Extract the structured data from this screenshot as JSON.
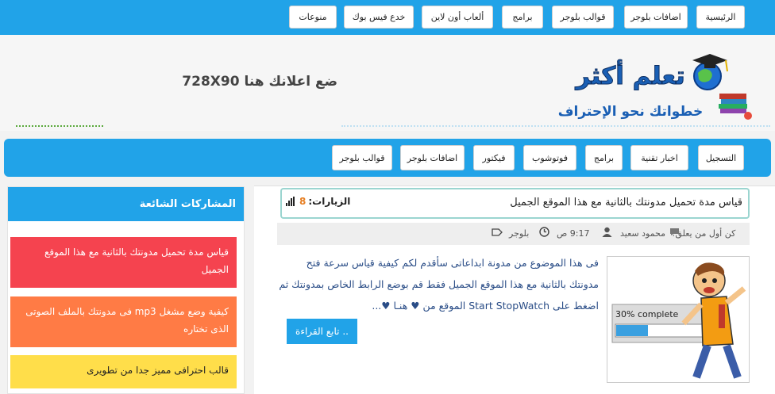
{
  "top_menu": [
    "الرئيسية",
    "اضافات بلوجر",
    "قوالب بلوجر",
    "برامج",
    "ألعاب أون لاين",
    "خدع فيس بوك",
    "منوعات"
  ],
  "header": {
    "logo_title": "تعلم أكثر",
    "logo_tagline": "خطواتك نحو الإحتراف",
    "ad_text": "ضع اعلانك هنا 728X90"
  },
  "nav_menu": [
    "التسجيل",
    "اخبار تقنية",
    "برامج",
    "فوتوشوب",
    "فيكتور",
    "اضافات بلوجر",
    "قوالب بلوجر"
  ],
  "sidebar": {
    "title": "المشاركات الشائعة",
    "posts": [
      {
        "title": "قياس مدة تحميل مدونتك بالثانية مع هذا الموقع الجميل",
        "color": "#f5434f"
      },
      {
        "title": "كيفية وضع مشغل mp3 فى مدونتك بالملف الصوتى الذى تختاره",
        "color": "#ff7b45"
      },
      {
        "title": "قالب احترافى مميز جدا من تطويرى",
        "color": "#ffde4a"
      }
    ]
  },
  "post": {
    "title": "قياس مدة تحميل مدونتك بالثانية مع هذا الموقع الجميل",
    "visits_label": "الزيارات:",
    "visits_count": "8",
    "author": "محمود سعيد",
    "time": "9:17 ص",
    "label": "بلوجر",
    "comments": "كن أول من يعلق!",
    "excerpt": "فى هذا الموضوع من مدونة ابداعاتى سأقدم لكم كيفية قياس سرعة فتح مدونتك بالثانية مع هذا الموقع الجميل فقط قم بوضع الرابط الخاص بمدونتك ثم اضغط على Start StopWatch  الموقع من ♥ هنـا ♥...",
    "read_more": "تابع القراءة ..",
    "thumb_text": "30% complete"
  },
  "colors": {
    "accent": "#21a3e8",
    "title_border": "#9bd5d0",
    "visits_count": "#e67e22",
    "excerpt_text": "#2a4d87"
  }
}
